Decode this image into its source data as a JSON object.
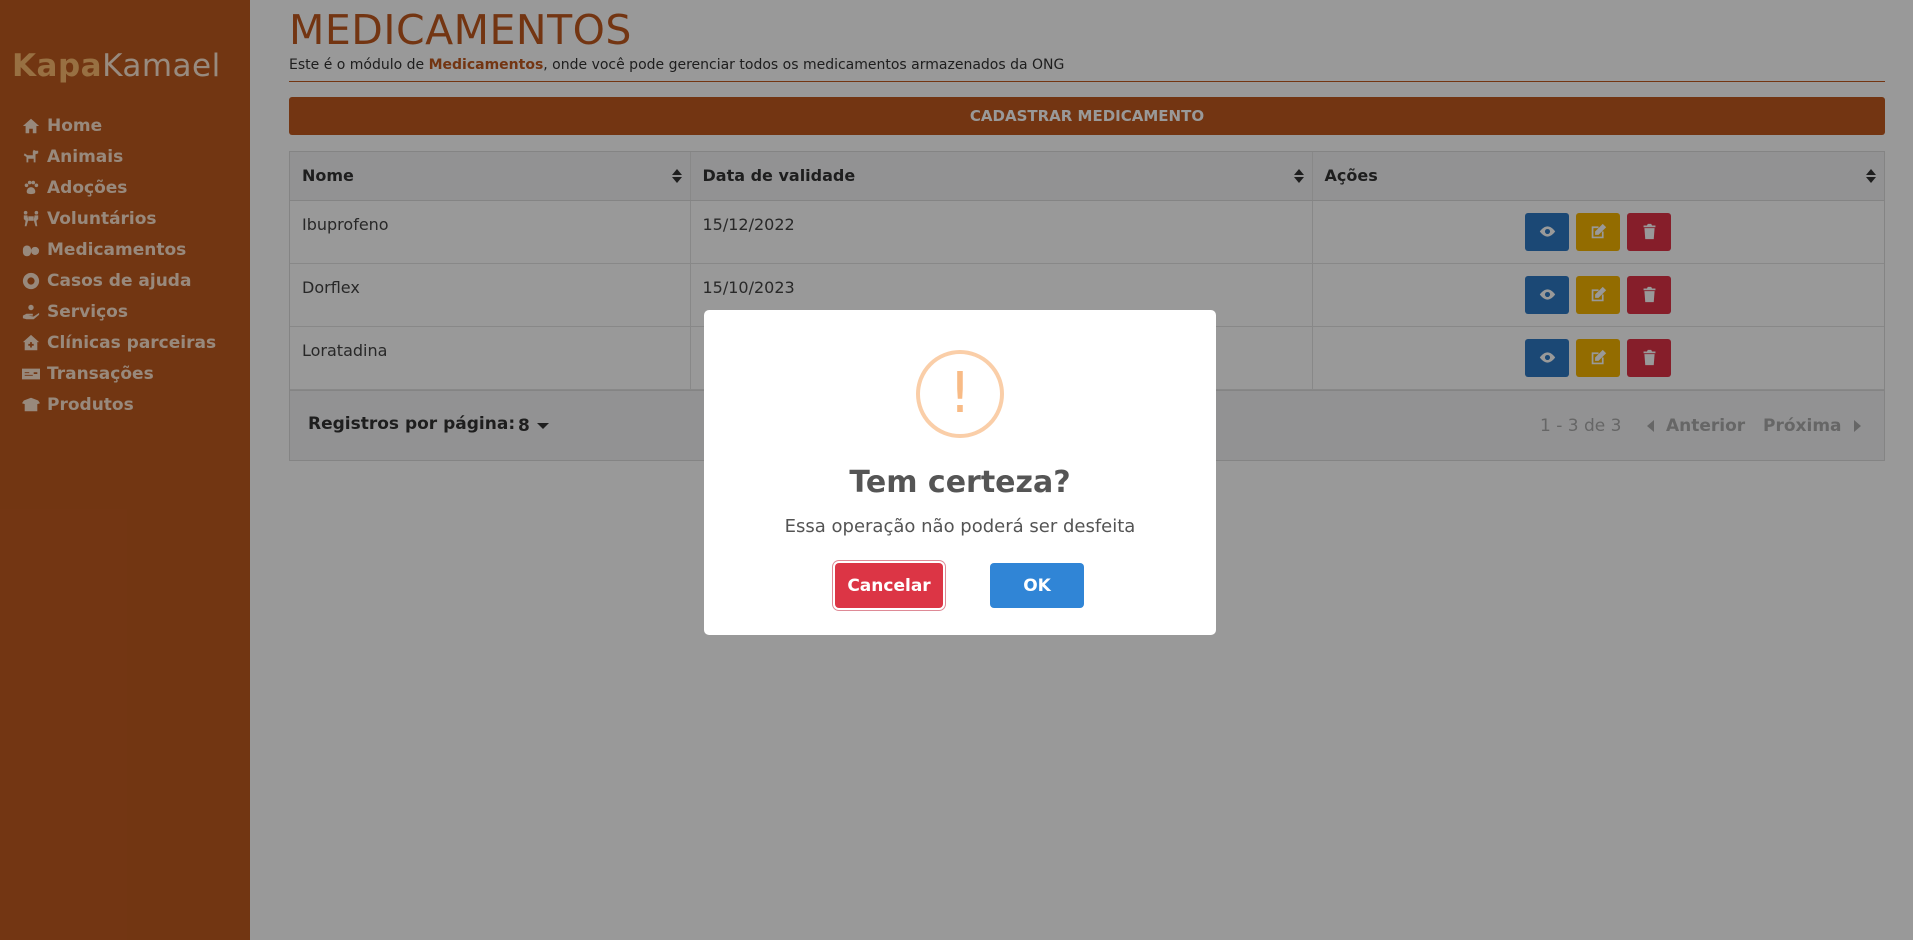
{
  "app": {
    "logo_part1": "Kapa",
    "logo_part2": "Kamael"
  },
  "sidebar": {
    "items": [
      {
        "label": "Home",
        "icon": "home-icon"
      },
      {
        "label": "Animais",
        "icon": "dog-icon"
      },
      {
        "label": "Adoções",
        "icon": "paw-icon"
      },
      {
        "label": "Voluntários",
        "icon": "people-carry-icon"
      },
      {
        "label": "Medicamentos",
        "icon": "pills-icon"
      },
      {
        "label": "Casos de ajuda",
        "icon": "life-ring-icon"
      },
      {
        "label": "Serviços",
        "icon": "hand-holding-icon"
      },
      {
        "label": "Clínicas parceiras",
        "icon": "clinic-house-icon"
      },
      {
        "label": "Transações",
        "icon": "money-check-icon"
      },
      {
        "label": "Produtos",
        "icon": "box-open-icon"
      }
    ]
  },
  "page": {
    "title": "MEDICAMENTOS",
    "subtitle_prefix": "Este é o módulo de ",
    "subtitle_bold": "Medicamentos",
    "subtitle_suffix": ", onde você pode gerenciar todos os medicamentos armazenados da ONG",
    "add_button": "CADASTRAR MEDICAMENTO"
  },
  "table": {
    "columns": [
      "Nome",
      "Data de validade",
      "Ações"
    ],
    "rows": [
      {
        "nome": "Ibuprofeno",
        "validade": "15/12/2022"
      },
      {
        "nome": "Dorflex",
        "validade": "15/10/2023"
      },
      {
        "nome": "Loratadina",
        "validade": "1"
      }
    ],
    "footer": {
      "rows_per_page_label": "Registros por página:",
      "rows_per_page_value": "8",
      "range": "1 - 3 de 3",
      "prev": "Anterior",
      "next": "Próxima"
    }
  },
  "dialog": {
    "icon_symbol": "!",
    "title": "Tem certeza?",
    "text": "Essa operação não poderá ser desfeita",
    "cancel": "Cancelar",
    "ok": "OK"
  },
  "colors": {
    "brand": "#c0591f",
    "view": "#2d79c4",
    "edit": "#f5b400",
    "delete": "#e03347",
    "ok": "#3085d6",
    "cancel": "#dc3545"
  }
}
